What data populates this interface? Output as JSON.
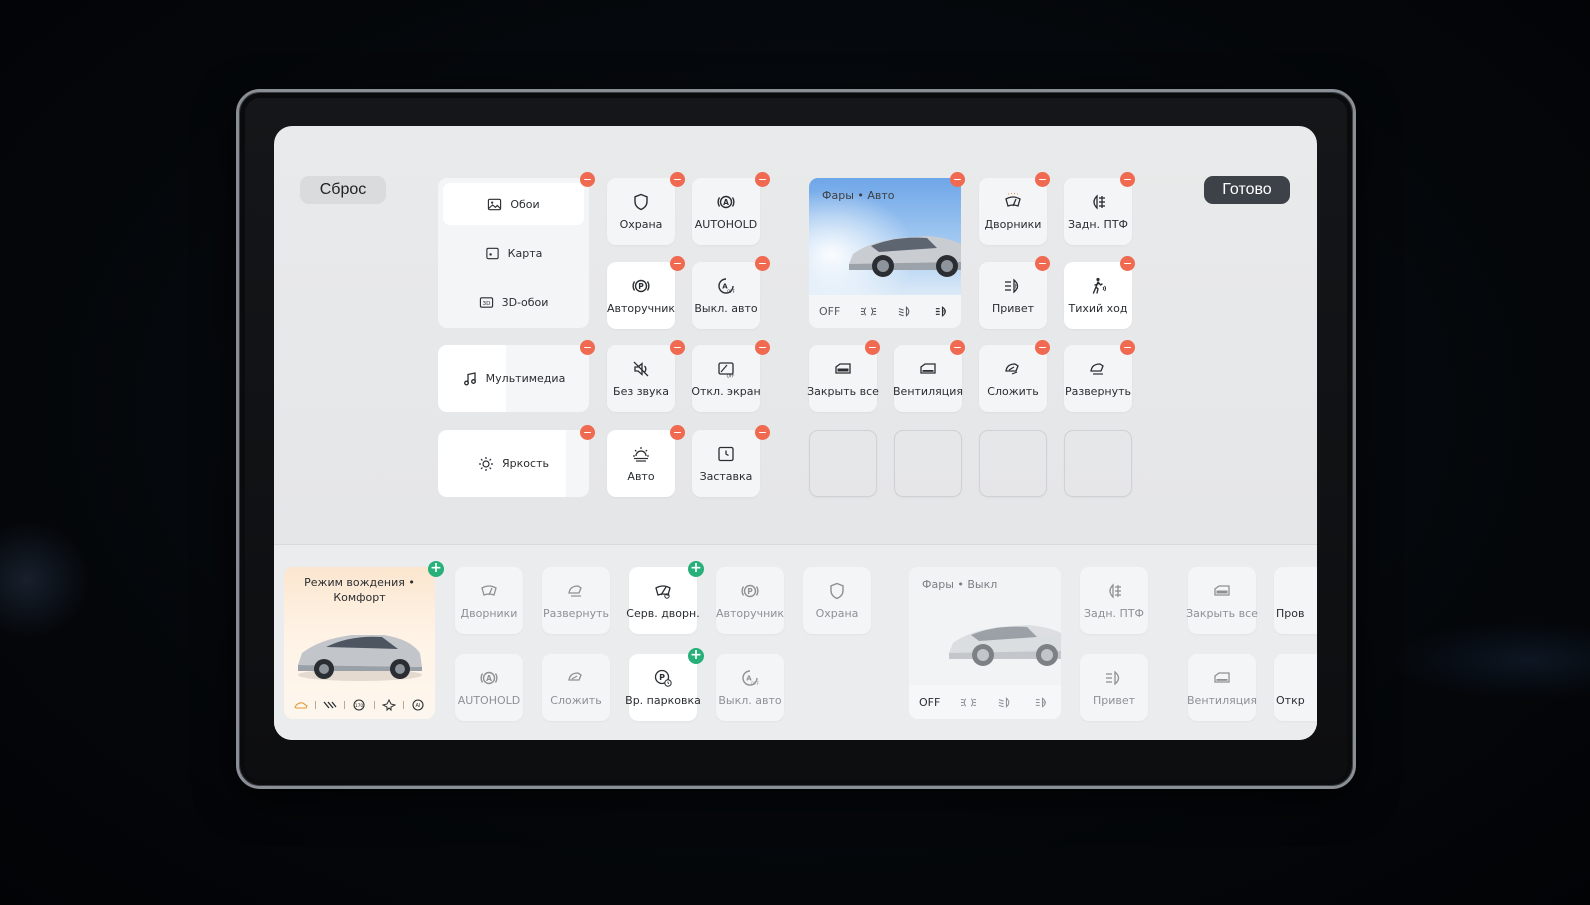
{
  "header": {
    "reset_label": "Сброс",
    "done_label": "Готово"
  },
  "display_menu": {
    "items": [
      {
        "label": "Обои",
        "icon": "image-icon",
        "selected": true
      },
      {
        "label": "Карта",
        "icon": "map-icon",
        "selected": false
      },
      {
        "label": "3D-обои",
        "icon": "3d-icon",
        "selected": false
      }
    ]
  },
  "multimedia": {
    "label": "Мультимедиа",
    "icon": "music-note-icon",
    "level": 0.45
  },
  "brightness": {
    "label": "Яркость",
    "icon": "sun-icon",
    "level": 0.85
  },
  "active_tiles": {
    "security": "Охрана",
    "autohold": "AUTOHOLD",
    "handbrake": "Авторучник",
    "auto_off": "Выкл. авто",
    "mute": "Без звука",
    "screen_off": "Откл. экран",
    "auto": "Авто",
    "screensaver": "Заставка",
    "wipers": "Дворники",
    "rear_fog": "Задн. ПТФ",
    "greeting": "Привет",
    "quiet_mode": "Тихий ход",
    "close_all": "Закрыть все",
    "ventilation": "Вентиляция",
    "fold": "Сложить",
    "unfold": "Развернуть"
  },
  "headlights_active": {
    "label": "Фары",
    "state": "Авто",
    "off_label": "OFF",
    "bullet": "•"
  },
  "available": {
    "drive_mode": {
      "label": "Режим вождения",
      "state": "Комфорт",
      "bullet": "•"
    },
    "tiles": {
      "wipers": "Дворники",
      "unfold": "Развернуть",
      "service_wipers": "Серв. дворн.",
      "handbrake": "Авторучник",
      "security": "Охрана",
      "autohold": "AUTOHOLD",
      "fold": "Сложить",
      "temp_parking": "Вр. парковка",
      "auto_off": "Выкл. авто",
      "rear_fog": "Задн. ПТФ",
      "greeting": "Привет",
      "close_all": "Закрыть все",
      "ventilation": "Вентиляция",
      "check_partial": "Пров",
      "open_partial": "Откр"
    },
    "headlights": {
      "label": "Фары",
      "state": "Выкл",
      "off_label": "OFF",
      "bullet": "•"
    }
  },
  "colors": {
    "remove_badge": "#ef6a50",
    "add_badge": "#27b07a",
    "done_button": "#3d4248"
  }
}
